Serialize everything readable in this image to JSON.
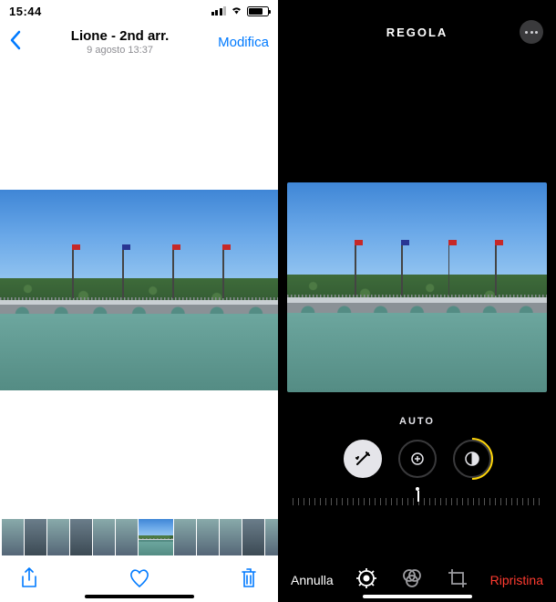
{
  "left": {
    "status": {
      "time": "15:44"
    },
    "nav": {
      "title": "Lione - 2nd arr.",
      "subtitle": "9 agosto  13:37",
      "edit": "Modifica"
    }
  },
  "right": {
    "nav": {
      "title": "REGOLA"
    },
    "adjust_label": "AUTO",
    "toolbar": {
      "cancel": "Annulla",
      "reset": "Ripristina"
    }
  }
}
